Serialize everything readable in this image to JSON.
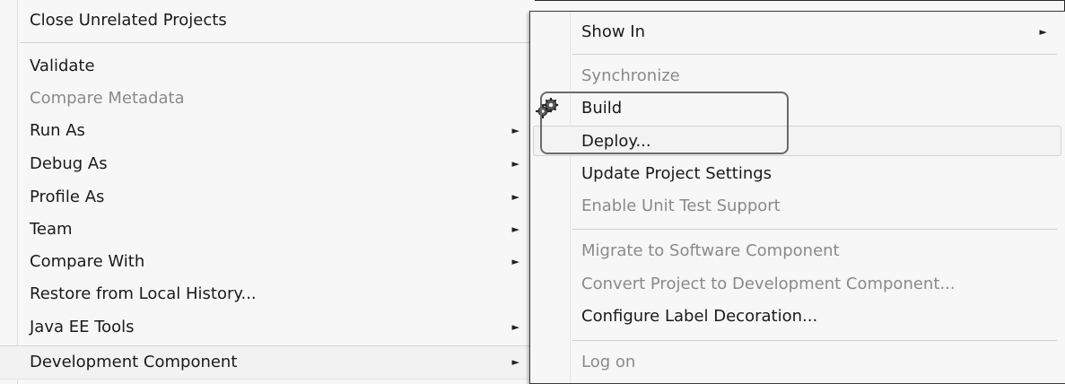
{
  "left_menu": {
    "items": [
      {
        "label": "Close Unrelated Projects",
        "enabled": true,
        "submenu": false
      },
      {
        "label": "Validate",
        "enabled": true,
        "submenu": false
      },
      {
        "label": "Compare Metadata",
        "enabled": false,
        "submenu": false
      },
      {
        "label": "Run As",
        "enabled": true,
        "submenu": true
      },
      {
        "label": "Debug As",
        "enabled": true,
        "submenu": true
      },
      {
        "label": "Profile As",
        "enabled": true,
        "submenu": true
      },
      {
        "label": "Team",
        "enabled": true,
        "submenu": true
      },
      {
        "label": "Compare With",
        "enabled": true,
        "submenu": true
      },
      {
        "label": "Restore from Local History...",
        "enabled": true,
        "submenu": false
      },
      {
        "label": "Java EE Tools",
        "enabled": true,
        "submenu": true
      },
      {
        "label": "Development Component",
        "enabled": true,
        "submenu": true,
        "highlighted": true
      }
    ]
  },
  "submenu": {
    "items": [
      {
        "label": "Show In",
        "enabled": true,
        "submenu": true
      },
      {
        "label": "Synchronize",
        "enabled": false
      },
      {
        "label": "Build",
        "enabled": true,
        "icon": "gear-icon"
      },
      {
        "label": "Deploy...",
        "enabled": true,
        "highlighted": true
      },
      {
        "label": "Update Project Settings",
        "enabled": true
      },
      {
        "label": "Enable Unit Test Support",
        "enabled": false
      },
      {
        "label": "Migrate to Software Component",
        "enabled": false
      },
      {
        "label": "Convert Project to Development Component...",
        "enabled": false
      },
      {
        "label": "Configure Label Decoration...",
        "enabled": true
      },
      {
        "label": "Log on",
        "enabled": false
      }
    ]
  },
  "glyphs": {
    "submenu_arrow": "►"
  },
  "colors": {
    "menu_bg": "#f7f7f7",
    "disabled_text": "#8a8a8a",
    "callout_border": "#6a6a6a"
  }
}
